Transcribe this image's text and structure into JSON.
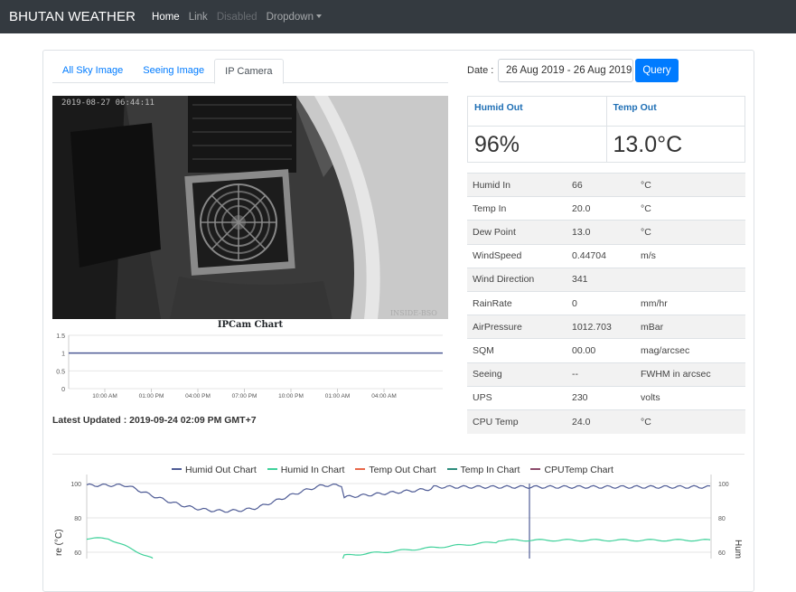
{
  "navbar": {
    "brand": "BHUTAN WEATHER",
    "items": [
      {
        "label": "Home",
        "state": "active"
      },
      {
        "label": "Link",
        "state": "normal"
      },
      {
        "label": "Disabled",
        "state": "disabled"
      },
      {
        "label": "Dropdown",
        "state": "dropdown"
      }
    ]
  },
  "tabs": [
    "All Sky Image",
    "Seeing Image",
    "IP Camera"
  ],
  "camera": {
    "timestamp": "2019-08-27 06:44:11",
    "watermark": "INSIDE-BSO"
  },
  "ipcam_chart": {
    "title": "IPCam Chart",
    "yticks": [
      "1.5",
      "1",
      "0.5",
      "0"
    ],
    "xticks": [
      "10:00 AM",
      "01:00 PM",
      "04:00 PM",
      "07:00 PM",
      "10:00 PM",
      "01:00 AM",
      "04:00 AM"
    ]
  },
  "latest_updated": "Latest Updated : 2019-09-24 02:09 PM GMT+7",
  "date": {
    "label": "Date :",
    "value": "26 Aug 2019 - 26 Aug 2019",
    "button": "Query"
  },
  "big_stats": [
    {
      "label": "Humid Out",
      "value": "96%"
    },
    {
      "label": "Temp Out",
      "value": "13.0°C"
    }
  ],
  "stats": [
    [
      "Humid In",
      "66",
      "°C"
    ],
    [
      "Temp In",
      "20.0",
      "°C"
    ],
    [
      "Dew Point",
      "13.0",
      "°C"
    ],
    [
      "WindSpeed",
      "0.44704",
      "m/s"
    ],
    [
      "Wind Direction",
      "341",
      ""
    ],
    [
      "RainRate",
      "0",
      "mm/hr"
    ],
    [
      "AirPressure",
      "1012.703",
      "mBar"
    ],
    [
      "SQM",
      "00.00",
      "mag/arcsec"
    ],
    [
      "Seeing",
      "--",
      "FWHM in arcsec"
    ],
    [
      "UPS",
      "230",
      "volts"
    ],
    [
      "CPU Temp",
      "24.0",
      "°C"
    ]
  ],
  "main_chart": {
    "legend": [
      {
        "name": "Humid Out Chart",
        "color": "#4e5b95"
      },
      {
        "name": "Humid In Chart",
        "color": "#3fd19a"
      },
      {
        "name": "Temp Out Chart",
        "color": "#e8684a"
      },
      {
        "name": "Temp In Chart",
        "color": "#2c8c7c"
      },
      {
        "name": "CPUTemp Chart",
        "color": "#8c4a6a"
      }
    ],
    "left_ticks": [
      "100",
      "80",
      "60"
    ],
    "right_ticks": [
      "100",
      "80",
      "60"
    ],
    "left_axis_label": "re (°C)",
    "right_axis_label": "Hum"
  },
  "chart_data": {
    "type": "line",
    "title": "IPCam Chart",
    "x": [
      "10:00 AM",
      "01:00 PM",
      "04:00 PM",
      "07:00 PM",
      "10:00 PM",
      "01:00 AM",
      "04:00 AM"
    ],
    "series": [
      {
        "values": [
          1,
          1,
          1,
          1,
          1,
          1,
          1
        ]
      }
    ],
    "ylim": [
      0,
      1.5
    ]
  }
}
